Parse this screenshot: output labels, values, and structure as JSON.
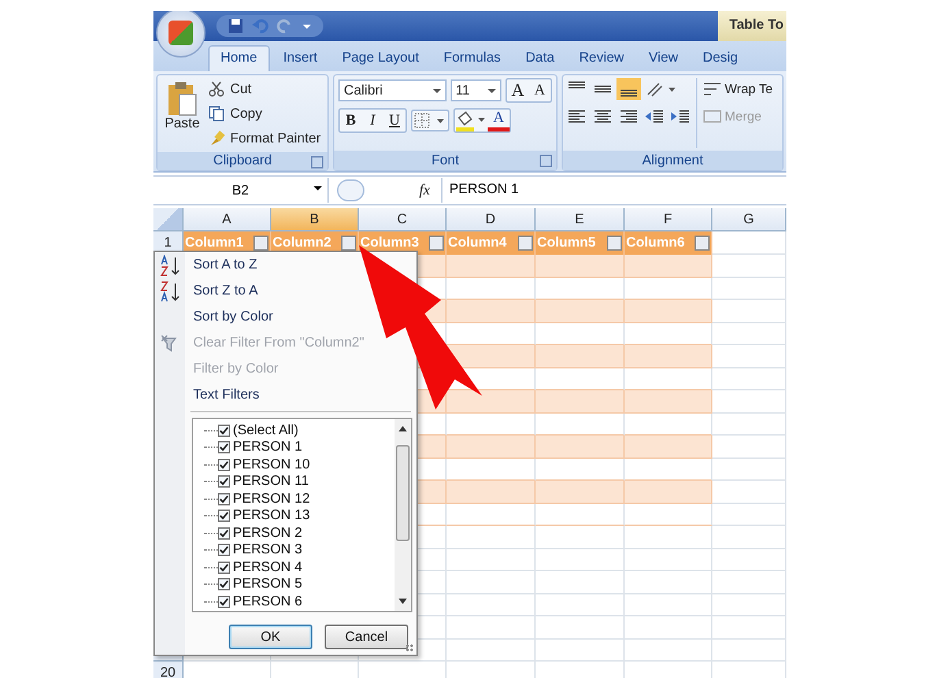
{
  "title_bar": {
    "title": "Table To"
  },
  "ribbon_tabs": [
    {
      "label": "Home",
      "selected": true
    },
    {
      "label": "Insert",
      "selected": false
    },
    {
      "label": "Page Layout",
      "selected": false
    },
    {
      "label": "Formulas",
      "selected": false
    },
    {
      "label": "Data",
      "selected": false
    },
    {
      "label": "Review",
      "selected": false
    },
    {
      "label": "View",
      "selected": false
    },
    {
      "label": "Desig",
      "selected": false
    }
  ],
  "clipboard": {
    "paste": "Paste",
    "cut": "Cut",
    "copy": "Copy",
    "format_painter": "Format Painter",
    "label": "Clipboard"
  },
  "font": {
    "family": "Calibri",
    "size": "11",
    "grow": "A",
    "shrink": "A",
    "bold": "B",
    "italic": "I",
    "underline": "U",
    "font_color_button": "A",
    "label": "Font"
  },
  "alignment": {
    "wrap": "Wrap Te",
    "merge": "Merge",
    "label": "Alignment"
  },
  "formula_bar": {
    "name_box": "B2",
    "fx": "fx",
    "value": "PERSON 1"
  },
  "sheet": {
    "columns": [
      {
        "label": "A",
        "selected": false
      },
      {
        "label": "B",
        "selected": true
      },
      {
        "label": "C",
        "selected": false
      },
      {
        "label": "D",
        "selected": false
      },
      {
        "label": "E",
        "selected": false
      },
      {
        "label": "F",
        "selected": false
      },
      {
        "label": "G",
        "selected": false
      }
    ],
    "header_row": {
      "number": "1",
      "cells": [
        "Column1",
        "Column2",
        "Column3",
        "Column4",
        "Column5",
        "Column6"
      ]
    },
    "rows": [
      {
        "in_table": true
      },
      {
        "in_table": true
      },
      {
        "in_table": true
      },
      {
        "in_table": true
      },
      {
        "in_table": true
      },
      {
        "in_table": true
      },
      {
        "in_table": true
      },
      {
        "in_table": true
      },
      {
        "in_table": true
      },
      {
        "in_table": true
      },
      {
        "in_table": true
      },
      {
        "in_table": true
      },
      {
        "in_table": false
      },
      {
        "in_table": false
      },
      {
        "in_table": false
      },
      {
        "in_table": false
      },
      {
        "in_table": false
      },
      {
        "in_table": false
      }
    ],
    "last_row": "20"
  },
  "filter_menu": {
    "items": [
      {
        "label": "Sort A to Z",
        "kind": "ascending",
        "disabled": false
      },
      {
        "label": "Sort Z to A",
        "kind": "descending",
        "disabled": false
      },
      {
        "label": "Sort by Color",
        "kind": "plain",
        "disabled": false
      },
      {
        "label": "Clear Filter From \"Column2\"",
        "kind": "clear",
        "disabled": true
      },
      {
        "label": "Filter by Color",
        "kind": "plain",
        "disabled": true
      },
      {
        "label": "Text Filters",
        "kind": "plain",
        "disabled": false
      }
    ],
    "values": [
      {
        "label": "(Select All)",
        "checked": true
      },
      {
        "label": "PERSON 1",
        "checked": true
      },
      {
        "label": "PERSON 10",
        "checked": true
      },
      {
        "label": "PERSON 11",
        "checked": true
      },
      {
        "label": "PERSON 12",
        "checked": true
      },
      {
        "label": "PERSON 13",
        "checked": true
      },
      {
        "label": "PERSON 2",
        "checked": true
      },
      {
        "label": "PERSON 3",
        "checked": true
      },
      {
        "label": "PERSON 4",
        "checked": true
      },
      {
        "label": "PERSON 5",
        "checked": true
      },
      {
        "label": "PERSON 6",
        "checked": true
      }
    ],
    "buttons": [
      "OK",
      "Cancel"
    ]
  }
}
